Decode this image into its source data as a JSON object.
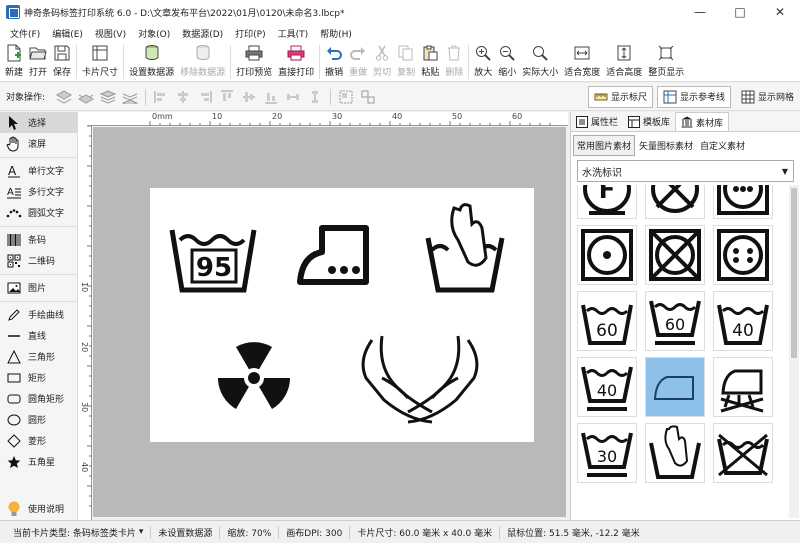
{
  "window": {
    "title": "神奇条码标签打印系统 6.0 - D:\\文章发布平台\\2022\\01月\\0120\\未命名3.lbcp*"
  },
  "menu": [
    "文件(F)",
    "编辑(E)",
    "视图(V)",
    "对象(O)",
    "数据源(D)",
    "打印(P)",
    "工具(T)",
    "帮助(H)"
  ],
  "toolbar": {
    "new": "新建",
    "open": "打开",
    "save": "保存",
    "card_size": "卡片尺寸",
    "setup_datasource": "设置数据源",
    "remove_datasource": "移除数据源",
    "print_preview": "打印预览",
    "direct_print": "直接打印",
    "undo": "撤销",
    "redo": "重做",
    "cut": "剪切",
    "copy": "复制",
    "paste": "粘贴",
    "delete": "删除",
    "zoom_in": "放大",
    "zoom_out": "缩小",
    "actual_size": "实际大小",
    "fit_width": "适合宽度",
    "fit_height": "适合高度",
    "full_page": "整页显示"
  },
  "objbar": {
    "label": "对象操作:",
    "show_ruler": "显示标尺",
    "show_guides": "显示参考线",
    "show_grid": "显示网格"
  },
  "palette": {
    "select": "选择",
    "scroll": "滚屏",
    "single_text": "单行文字",
    "multi_text": "多行文字",
    "arc_text": "圆弧文字",
    "barcode": "条码",
    "qrcode": "二维码",
    "image": "图片",
    "freehand": "手绘曲线",
    "line": "直线",
    "triangle": "三角形",
    "rect": "矩形",
    "rounded_rect": "圆角矩形",
    "circle": "圆形",
    "diamond": "菱形",
    "star": "五角星",
    "help": "使用说明"
  },
  "ruler": {
    "top": [
      "0mm",
      "10",
      "20",
      "30",
      "40",
      "50",
      "60"
    ],
    "left": [
      "10",
      "20",
      "30",
      "40"
    ]
  },
  "canvas": {
    "tub_number": "95"
  },
  "right_panel": {
    "tabs": [
      "属性栏",
      "模板库",
      "素材库"
    ],
    "subtabs": [
      "常用图片素材",
      "矢量图标素材",
      "自定义素材"
    ],
    "category": "水洗标识",
    "tiles": [
      {
        "icon": "dryclean-f-icon"
      },
      {
        "icon": "no-dryclean-icon"
      },
      {
        "icon": "tumble-dry-dots-icon"
      },
      {
        "icon": "tumble-dry-icon"
      },
      {
        "icon": "no-tumble-dry-icon"
      },
      {
        "icon": "tumble-dry-high-icon"
      },
      {
        "icon": "wash-60-icon",
        "label": "60"
      },
      {
        "icon": "wash-60-bar-icon",
        "label": "60"
      },
      {
        "icon": "wash-40-icon",
        "label": "40"
      },
      {
        "icon": "wash-40-bar-icon",
        "label": "40"
      },
      {
        "icon": "iron-icon"
      },
      {
        "icon": "no-steam-iron-icon"
      },
      {
        "icon": "wash-30-bar-icon",
        "label": "30"
      },
      {
        "icon": "hand-wash-icon"
      },
      {
        "icon": "no-wash-icon"
      }
    ]
  },
  "status": {
    "card_type_label": "当前卡片类型:",
    "card_type": "条码标签类卡片",
    "datasource": "未设置数据源",
    "zoom": "缩放: 70%",
    "dpi": "画布DPI: 300",
    "card_size": "卡片尺寸: 60.0 毫米 x 40.0 毫米",
    "mouse_pos": "鼠标位置: 51.5 毫米, -12.2 毫米"
  },
  "colors": {
    "accent": "#2a6db8",
    "selected_tile": "#8ec1ea",
    "workspace": "#b9b9b9"
  }
}
